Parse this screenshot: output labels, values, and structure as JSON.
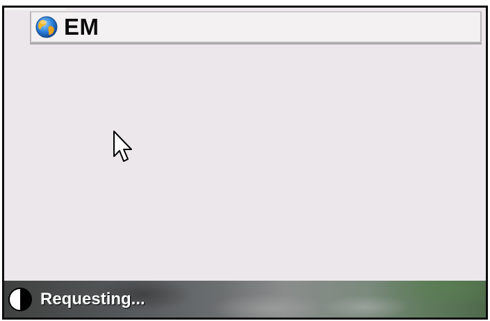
{
  "address_bar": {
    "text": "EM",
    "icon": "globe-icon"
  },
  "status_bar": {
    "text": "Requesting...",
    "icon": "half-circle-loading-icon"
  },
  "colors": {
    "frame_border": "#0d0d0d",
    "page_background": "#ebe7ea",
    "address_background": "#f3f1f2",
    "status_text": "#ffffff"
  }
}
